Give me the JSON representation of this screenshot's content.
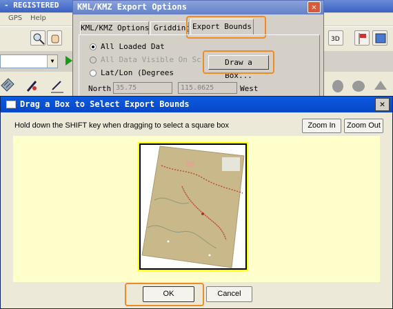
{
  "bg_app": {
    "title": "- REGISTERED",
    "menu": [
      "GPS",
      "Help"
    ]
  },
  "kml_dialog": {
    "title": "KML/KMZ Export Options",
    "tabs": [
      "KML/KMZ Options",
      "Gridding",
      "Export Bounds"
    ],
    "active_tab": "Export Bounds",
    "radio_all_loaded": "All Loaded Dat",
    "radio_all_visible": "All Data Visible On Sc",
    "radio_latlon": "Lat/Lon (Degrees",
    "north_label": "North",
    "north_value": "35.75",
    "field2_value": "115.0625",
    "west_label": "West",
    "draw_box_label": "Draw a Box..."
  },
  "drag_dialog": {
    "title": "Drag a Box to Select Export Bounds",
    "hint": "Hold down the SHIFT key when dragging to select a square box",
    "zoom_in": "Zoom In",
    "zoom_out": "Zoom Out",
    "ok": "OK",
    "cancel": "Cancel"
  },
  "colors": {
    "highlight": "#f08a24",
    "viewer_bg": "#ffffcc",
    "selection": "#ffff00",
    "map_tan": "#c9b98a"
  }
}
